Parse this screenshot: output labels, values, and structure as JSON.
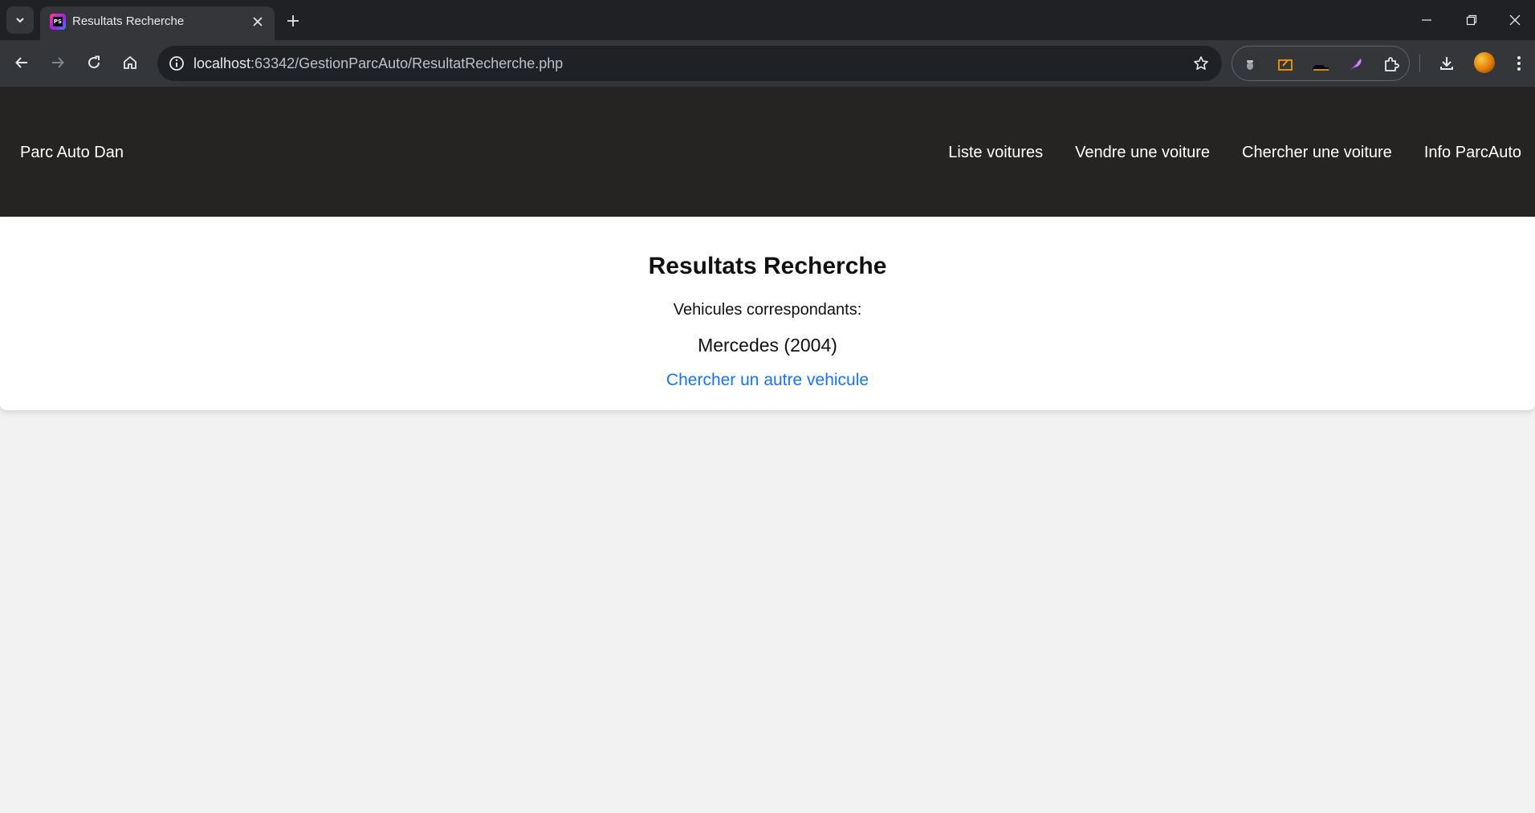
{
  "browser": {
    "tab": {
      "title": "Resultats Recherche",
      "favicon_text": "PS"
    },
    "address": {
      "host": "localhost",
      "path": ":63342/GestionParcAuto/ResultatRecherche.php"
    },
    "icons": [
      "tab-search-icon",
      "close-icon",
      "plus-icon",
      "minimize-icon",
      "restore-icon",
      "window-close-icon",
      "back-arrow-icon",
      "forward-arrow-icon",
      "reload-icon",
      "home-icon",
      "site-info-icon",
      "star-icon",
      "extension-icons",
      "puzzle-icon",
      "download-icon",
      "avatar",
      "kebab-menu-icon"
    ]
  },
  "site": {
    "brand": "Parc Auto Dan",
    "nav": [
      {
        "label": "Liste voitures"
      },
      {
        "label": "Vendre une voiture"
      },
      {
        "label": "Chercher une voiture"
      },
      {
        "label": "Info ParcAuto"
      }
    ]
  },
  "results": {
    "title": "Resultats Recherche",
    "subtitle": "Vehicules correspondants:",
    "items": [
      {
        "label": "Mercedes (2004)"
      }
    ],
    "search_again": "Chercher un autre vehicule"
  },
  "colors": {
    "chrome_dark": "#202124",
    "chrome_toolbar": "#35363a",
    "nav_background": "#252422",
    "page_background": "#f2f2f2",
    "link": "#1a73e8"
  }
}
